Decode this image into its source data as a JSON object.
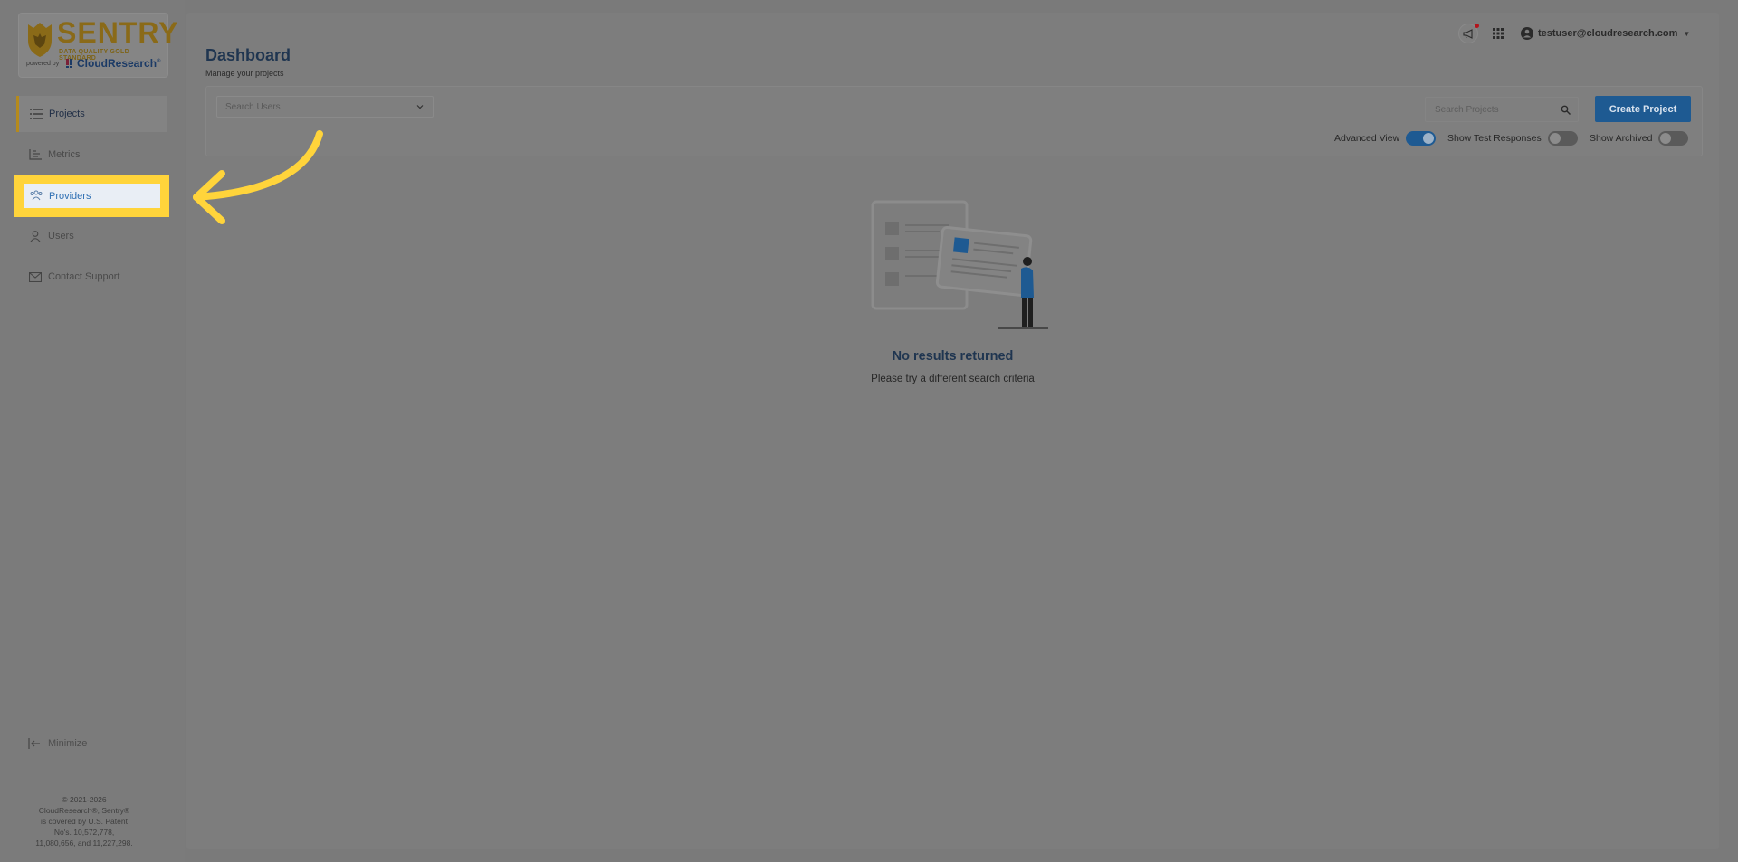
{
  "app": {
    "logo_word": "SENTRY",
    "logo_tagline": "DATA QUALITY GOLD STANDARD",
    "logo_powered": "powered by",
    "logo_brand": "CloudResearch",
    "logo_brand_mark": "®"
  },
  "sidebar": {
    "items": [
      {
        "label": "Projects",
        "icon": "list-icon",
        "active": true
      },
      {
        "label": "Metrics",
        "icon": "bar-chart-icon",
        "active": false
      },
      {
        "label": "Providers",
        "icon": "people-group-icon",
        "active": false,
        "highlighted": true
      },
      {
        "label": "Users",
        "icon": "user-icon",
        "active": false
      },
      {
        "label": "Contact Support",
        "icon": "mail-icon",
        "active": false
      }
    ],
    "minimize_label": "Minimize",
    "footer": {
      "line1": "© 2021-2026",
      "line2": "CloudResearch®, Sentry®",
      "line3": "is covered by U.S. Patent",
      "line4": "No's. 10,572,778,",
      "line5": "11,080,656, and 11,227,298."
    }
  },
  "header": {
    "title": "Dashboard",
    "subtitle": "Manage your projects",
    "user_email": "testuser@cloudresearch.com"
  },
  "filters": {
    "search_users_placeholder": "Search Users",
    "search_projects_placeholder": "Search Projects",
    "create_project_label": "Create Project",
    "toggles": [
      {
        "label": "Advanced View",
        "on": true
      },
      {
        "label": "Show Test Responses",
        "on": false
      },
      {
        "label": "Show Archived",
        "on": false
      }
    ]
  },
  "empty_state": {
    "title": "No results returned",
    "subtitle": "Please try a different search criteria"
  },
  "colors": {
    "overlay": "#7a7a7a",
    "highlight": "#ffd43b",
    "accent": "#1e5a92",
    "brand_gold": "#b58a1c"
  }
}
